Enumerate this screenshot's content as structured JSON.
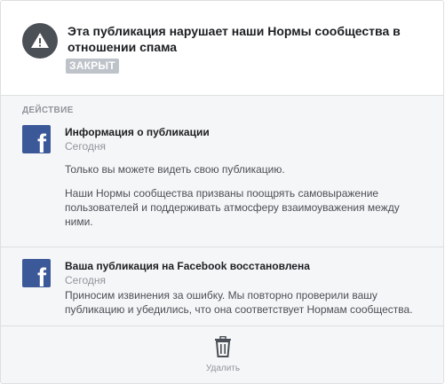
{
  "header": {
    "icon": "warning-icon",
    "title": "Эта публикация нарушает наши Нормы сообщества в отношении спама",
    "status": "ЗАКРЫТ"
  },
  "section": {
    "label": "ДЕЙСТВИЕ"
  },
  "items": [
    {
      "icon": "facebook-logo-icon",
      "title": "Информация о публикации",
      "date": "Сегодня",
      "paragraphs": [
        "Только вы можете видеть свою публикацию.",
        "Наши Нормы сообщества призваны поощрять самовыражение пользователей и поддерживать атмосферу взаимоуважения между ними."
      ]
    },
    {
      "icon": "facebook-logo-icon",
      "title": "Ваша публикация на Facebook восстановлена",
      "date": "Сегодня",
      "paragraphs": [
        "Приносим извинения за ошибку. Мы повторно проверили вашу публикацию и убедились, что она соответствует Нормам сообщества."
      ]
    }
  ],
  "footer": {
    "delete_icon": "trash-icon",
    "delete_label": "Удалить"
  },
  "colors": {
    "facebook_blue": "#3b5998",
    "badge_gray": "#bec3c9",
    "warning_circle": "#4b4f56"
  }
}
